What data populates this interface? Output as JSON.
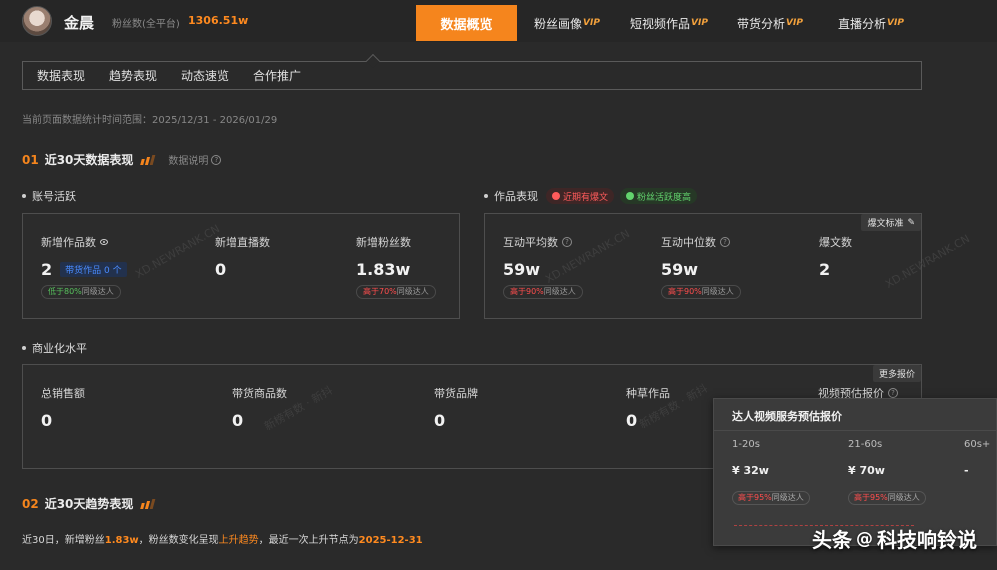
{
  "header": {
    "user_name": "金晨",
    "fans_label": "粉丝数(全平台)",
    "fans_value": "1306.51w",
    "nav": [
      {
        "label": "数据概览",
        "vip": ""
      },
      {
        "label": "粉丝画像",
        "vip": "VIP"
      },
      {
        "label": "短视频作品",
        "vip": "VIP"
      },
      {
        "label": "带货分析",
        "vip": "VIP"
      },
      {
        "label": "直播分析",
        "vip": "VIP"
      }
    ]
  },
  "subtabs": [
    "数据表现",
    "趋势表现",
    "动态速览",
    "合作推广"
  ],
  "range_text": "当前页面数据统计时间范围：2025/12/31 - 2026/01/29",
  "section1": {
    "num": "01",
    "title": "近30天数据表现",
    "help": "数据说明"
  },
  "account": {
    "heading": "账号活跃",
    "metrics": [
      {
        "label": "新增作品数",
        "value": "2",
        "badge": "带货作品 0 个",
        "compare_prefix": "",
        "compare_hl": "低于80%",
        "compare_suffix": "同级达人"
      },
      {
        "label": "新增直播数",
        "value": "0"
      },
      {
        "label": "新增粉丝数",
        "value": "1.83w",
        "compare_hl": "高于70%",
        "compare_suffix": "同级达人"
      }
    ]
  },
  "works": {
    "heading": "作品表现",
    "tag_red": "近期有爆文",
    "tag_green": "粉丝活跃度高",
    "corner_btn": "爆文标准",
    "metrics": [
      {
        "label": "互动平均数",
        "value": "59w",
        "compare_hl": "高于90%",
        "compare_suffix": "同级达人"
      },
      {
        "label": "互动中位数",
        "value": "59w",
        "compare_hl": "高于90%",
        "compare_suffix": "同级达人"
      },
      {
        "label": "爆文数",
        "value": "2"
      }
    ]
  },
  "commerce": {
    "heading": "商业化水平",
    "corner_btn": "更多报价",
    "metrics": [
      {
        "label": "总销售额",
        "value": "0"
      },
      {
        "label": "带货商品数",
        "value": "0"
      },
      {
        "label": "带货品牌",
        "value": "0"
      },
      {
        "label": "种草作品",
        "value": "0"
      },
      {
        "label": "视频预估报价"
      }
    ]
  },
  "popup": {
    "title": "达人视频服务预估报价",
    "cols": [
      {
        "h": "1-20s",
        "v": "¥ 32w",
        "c_hl": "高于95%",
        "c_suffix": "同级达人"
      },
      {
        "h": "21-60s",
        "v": "¥ 70w",
        "c_hl": "高于95%",
        "c_suffix": "同级达人"
      },
      {
        "h": "60s+",
        "v": "-"
      }
    ]
  },
  "section2": {
    "num": "02",
    "title": "近30天趋势表现"
  },
  "trend": {
    "p1": "近30日，新增粉丝",
    "v1": "1.83w",
    "p2": "，粉丝数变化呈现",
    "v2": "上升趋势",
    "p3": "，最近一次上升节点为",
    "v3": "2025-12-31"
  },
  "watermarks": [
    "XD.NEWRANK.CN",
    "新榜有数 · 新抖"
  ],
  "footer_mark": {
    "brand": "头条",
    "at": "@",
    "account": "科技响铃说"
  }
}
